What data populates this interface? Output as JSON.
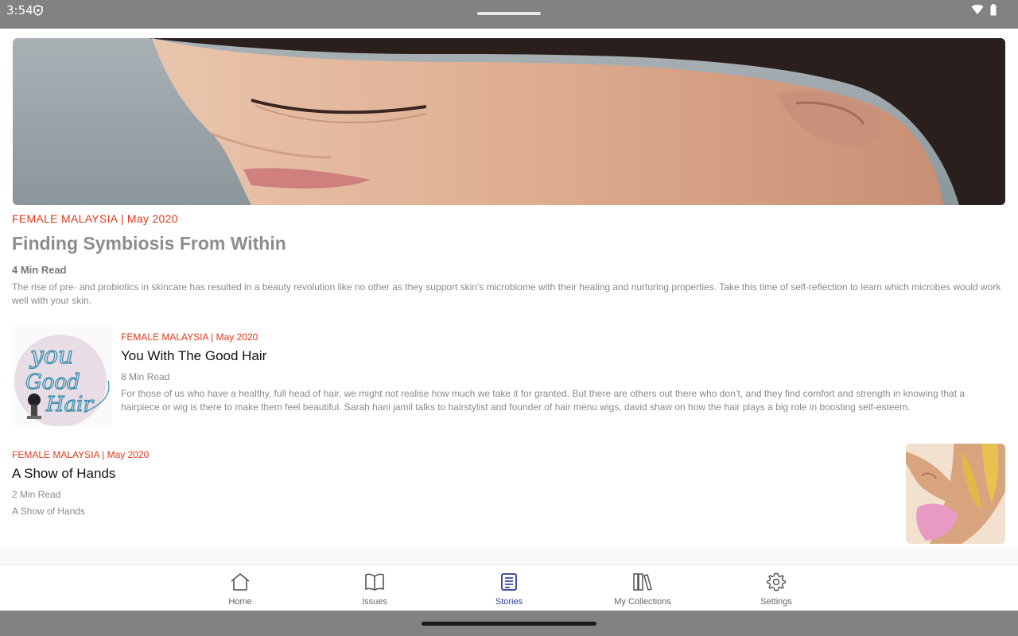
{
  "status_bar": {
    "time": "3:54",
    "icons": [
      "shield-icon",
      "wifi-icon",
      "battery-icon"
    ]
  },
  "colors": {
    "accent_red": "#e03a1e",
    "active_nav": "#2b3a9a",
    "system_bar": "#828282"
  },
  "hero": {
    "meta": "FEMALE MALAYSIA | May 2020",
    "title": "Finding Symbiosis From Within",
    "read_time": "4 Min Read",
    "excerpt": "The rise of pre- and probiotics in skincare has resulted in a beauty revolution like no other as they support skin's microbiome with their healing and nurturing properties. Take this time of self-reflection to learn which microbes would work well with your skin."
  },
  "stories": [
    {
      "meta": "FEMALE MALAYSIA | May 2020",
      "title": "You With The Good Hair",
      "read_time": "8 Min Read",
      "excerpt": "For those of us who have a healthy, full head of hair, we might not realise how much we take it for granted. But there are others out there who don’t, and they find comfort and strength in knowing that a hairpiece or wig is there to make them feel beautiful. Sarah hani jamil talks to hairstylist and founder of hair menu wigs, david shaw on how the hair plays a big role in boosting self-esteem.",
      "thumb_text": [
        "you",
        "Good",
        "Hair"
      ]
    },
    {
      "meta": "FEMALE MALAYSIA | May 2020",
      "title": "A Show of Hands",
      "read_time": "2 Min Read",
      "excerpt": "A Show of Hands"
    }
  ],
  "bottom_nav": [
    {
      "label": "Home",
      "icon": "home-icon",
      "active": false
    },
    {
      "label": "Issues",
      "icon": "book-icon",
      "active": false
    },
    {
      "label": "Stories",
      "icon": "stories-icon",
      "active": true
    },
    {
      "label": "My Collections",
      "icon": "collections-icon",
      "active": false
    },
    {
      "label": "Settings",
      "icon": "gear-icon",
      "active": false
    }
  ]
}
